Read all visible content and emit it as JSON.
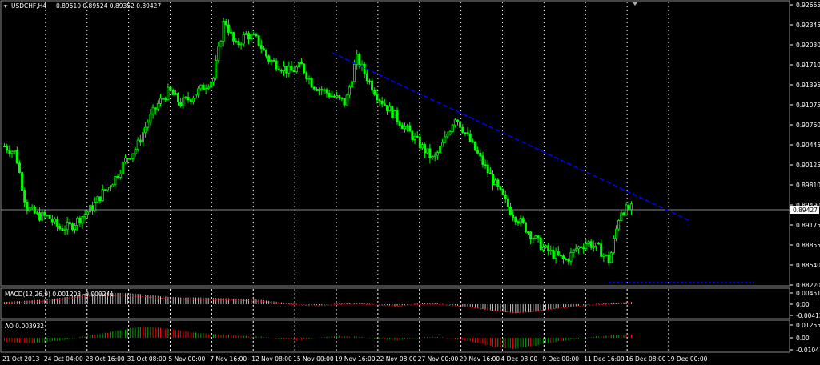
{
  "main": {
    "symbol_title": "USDCHF,H4",
    "ohlc": "0.89510 0.89524 0.89352 0.89427",
    "current_price": "0.89427",
    "price_ticks": [
      "0.92665",
      "0.92345",
      "0.92030",
      "0.91710",
      "0.91395",
      "0.91075",
      "0.90760",
      "0.90445",
      "0.90125",
      "0.89810",
      "0.89490",
      "0.89175",
      "0.88855",
      "0.88540",
      "0.88220"
    ]
  },
  "macd": {
    "label": "MACD(12,26,9) 0.001203 -0.000241",
    "ticks": [
      "0.004514",
      "0.00",
      "-0.004123"
    ]
  },
  "ao": {
    "label": "AO 0.003932",
    "ticks": [
      "0.012553",
      "0.00",
      "-0.010413"
    ]
  },
  "time_axis": {
    "labels": [
      "21 Oct 2013",
      "24 Oct 04:00",
      "28 Oct 16:00",
      "31 Oct 08:00",
      "5 Nov 00:00",
      "7 Nov 16:00",
      "12 Nov 08:00",
      "15 Nov 00:00",
      "19 Nov 16:00",
      "22 Nov 08:00",
      "27 Nov 00:00",
      "29 Nov 16:00",
      "4 Dec 08:00",
      "9 Dec 00:00",
      "11 Dec 16:00",
      "16 Dec 08:00",
      "19 Dec 00:00"
    ]
  },
  "colors": {
    "background": "#000000",
    "candles": "#00ff00",
    "grid": "#ffffff",
    "trendline": "#0000ff",
    "macd_hist": "#c0c0c0",
    "macd_signal": "#ff0000",
    "ao_up": "#00aa00",
    "ao_down": "#ff0000"
  },
  "chart_data": {
    "type": "candlestick",
    "series": [
      {
        "name": "USDCHF,H4",
        "close_path": [
          0.9042,
          0.9032,
          0.8945,
          0.8932,
          0.893,
          0.8912,
          0.8915,
          0.893,
          0.8945,
          0.897,
          0.899,
          0.902,
          0.904,
          0.908,
          0.911,
          0.913,
          0.911,
          0.912,
          0.9135,
          0.915,
          0.9245,
          0.92,
          0.922,
          0.921,
          0.918,
          0.917,
          0.916,
          0.917,
          0.914,
          0.913,
          0.912,
          0.911,
          0.9182,
          0.915,
          0.912,
          0.91,
          0.908,
          0.906,
          0.904,
          0.902,
          0.905,
          0.909,
          0.906,
          0.903,
          0.9,
          0.897,
          0.894,
          0.892,
          0.89,
          0.888,
          0.887,
          0.886,
          0.888,
          0.889,
          0.888,
          0.886,
          0.894,
          0.8943
        ]
      }
    ]
  }
}
